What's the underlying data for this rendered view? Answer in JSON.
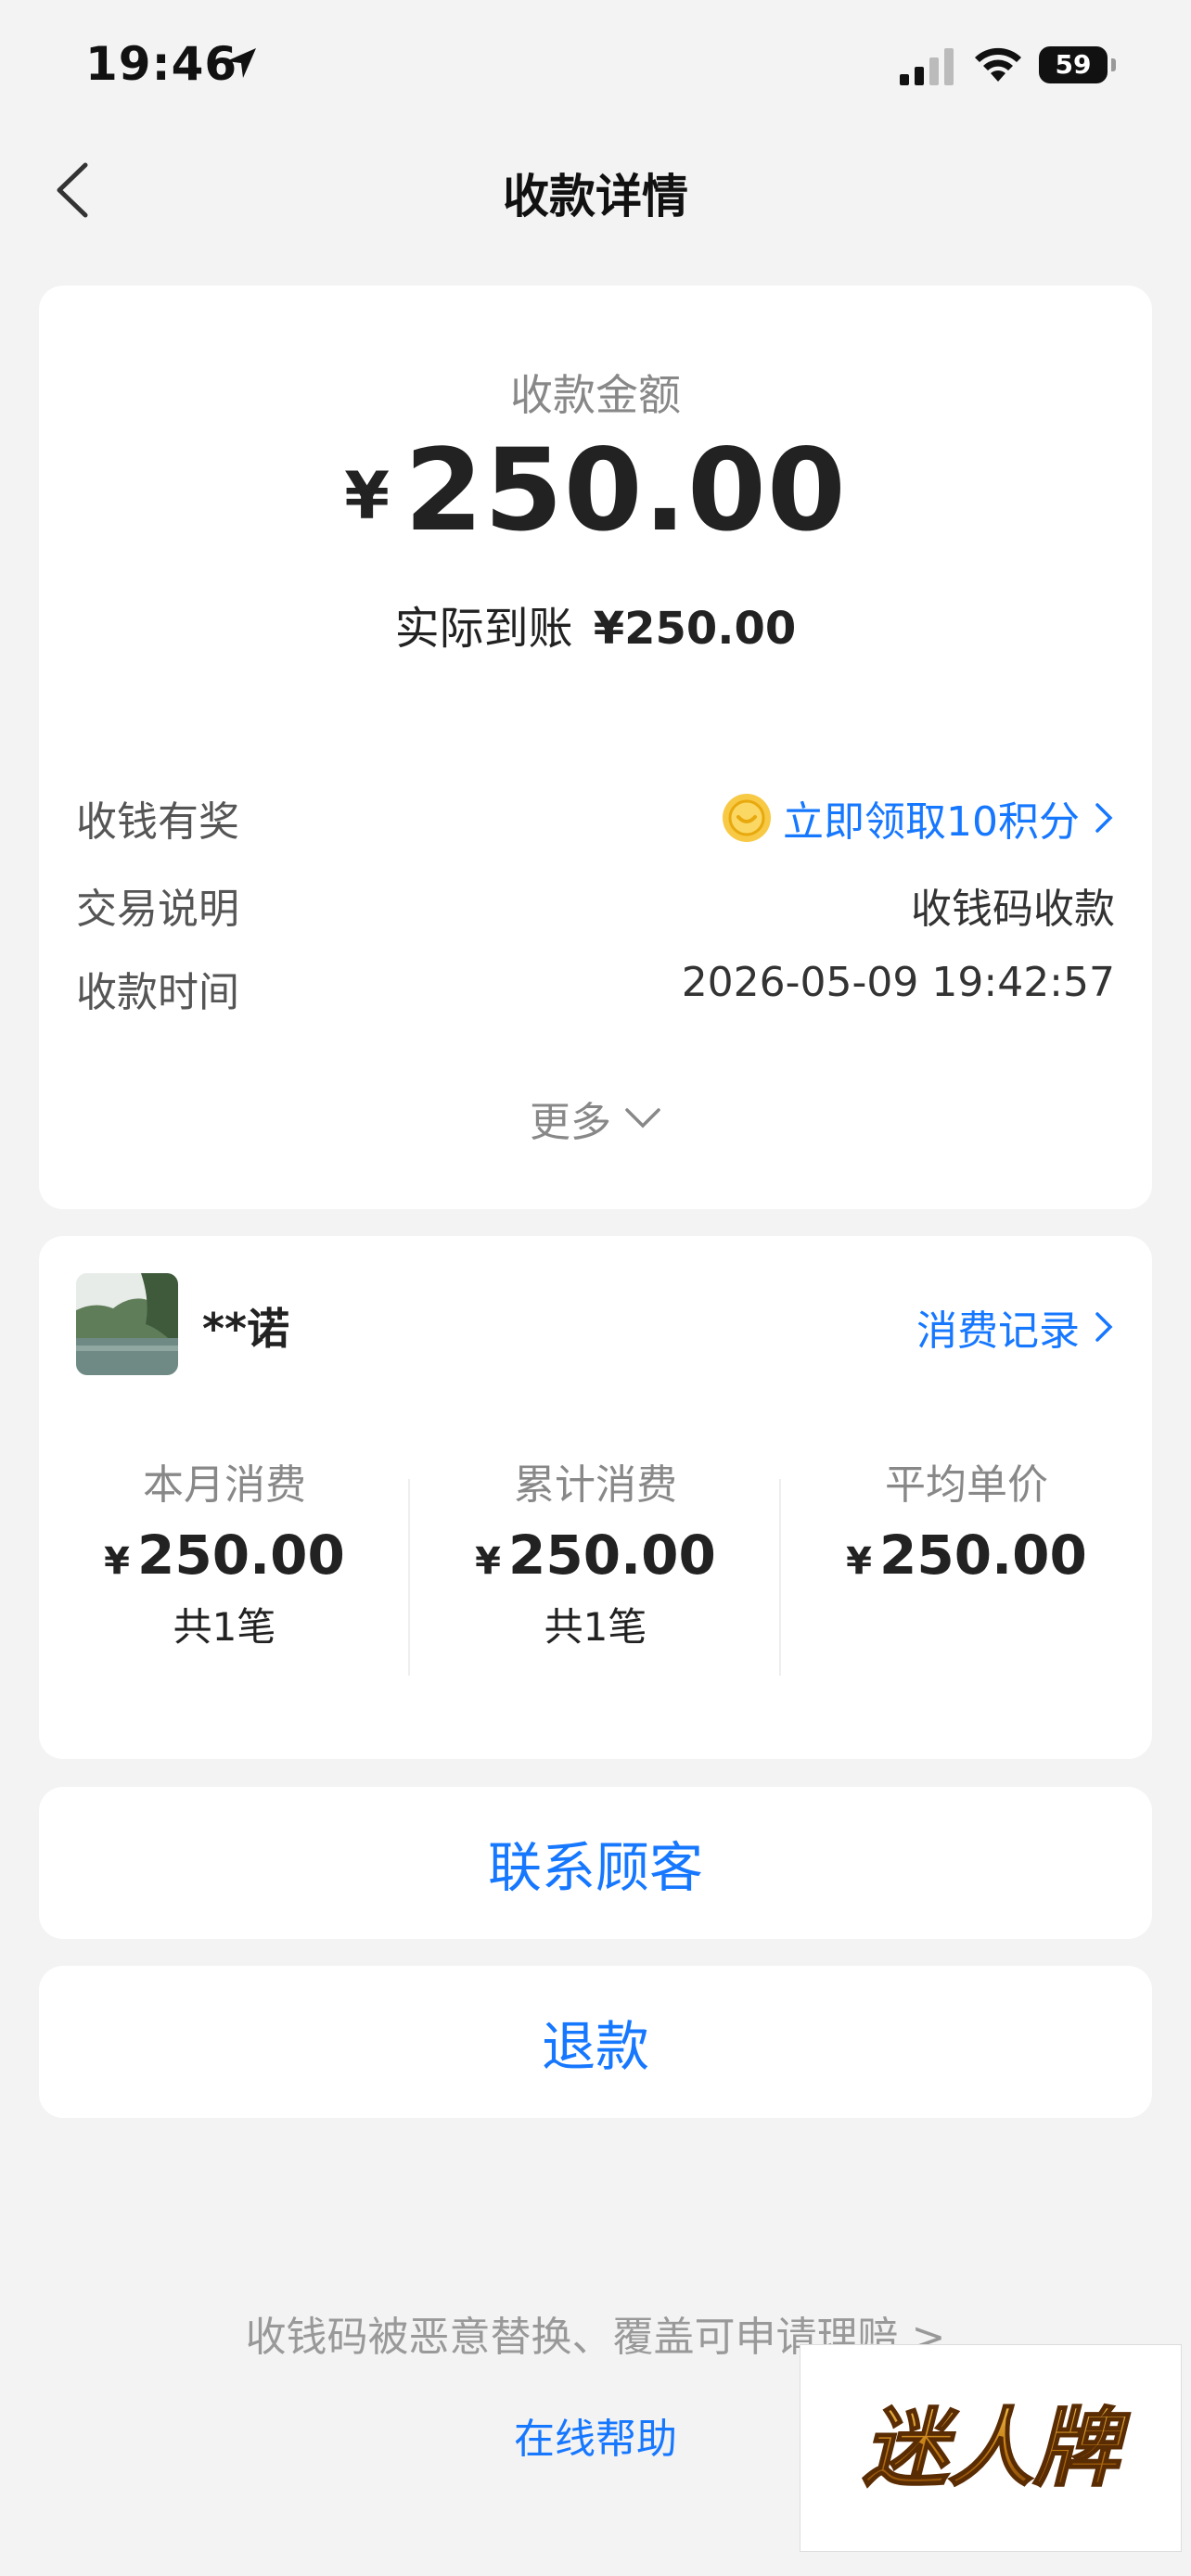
{
  "status_bar": {
    "time": "19:46",
    "battery": "59"
  },
  "nav": {
    "title": "收款详情"
  },
  "summary": {
    "amount_label": "收款金额",
    "currency_symbol": "¥",
    "amount": "250.00",
    "settled_label": "实际到账",
    "settled_value": "¥250.00",
    "rows": [
      {
        "label": "收钱有奖",
        "value": "立即领取10积分"
      },
      {
        "label": "交易说明",
        "value": "收钱码收款"
      },
      {
        "label": "收款时间",
        "value": "2026-05-09 19:42:57"
      }
    ],
    "more_label": "更多"
  },
  "customer": {
    "name": "**诺",
    "records_link": "消费记录",
    "stats": [
      {
        "label": "本月消费",
        "symbol": "¥",
        "value": "250.00",
        "count": "共1笔"
      },
      {
        "label": "累计消费",
        "symbol": "¥",
        "value": "250.00",
        "count": "共1笔"
      },
      {
        "label": "平均单价",
        "symbol": "¥",
        "value": "250.00"
      }
    ]
  },
  "actions": {
    "contact": "联系顾客",
    "refund": "退款"
  },
  "footer": {
    "claim_link": "收钱码被恶意替换、覆盖可申请理赔 >",
    "help_link": "在线帮助"
  },
  "watermark": {
    "text": "迷人牌"
  },
  "colors": {
    "link": "#1677ff",
    "background": "#f3f3f3",
    "card": "#ffffff"
  }
}
